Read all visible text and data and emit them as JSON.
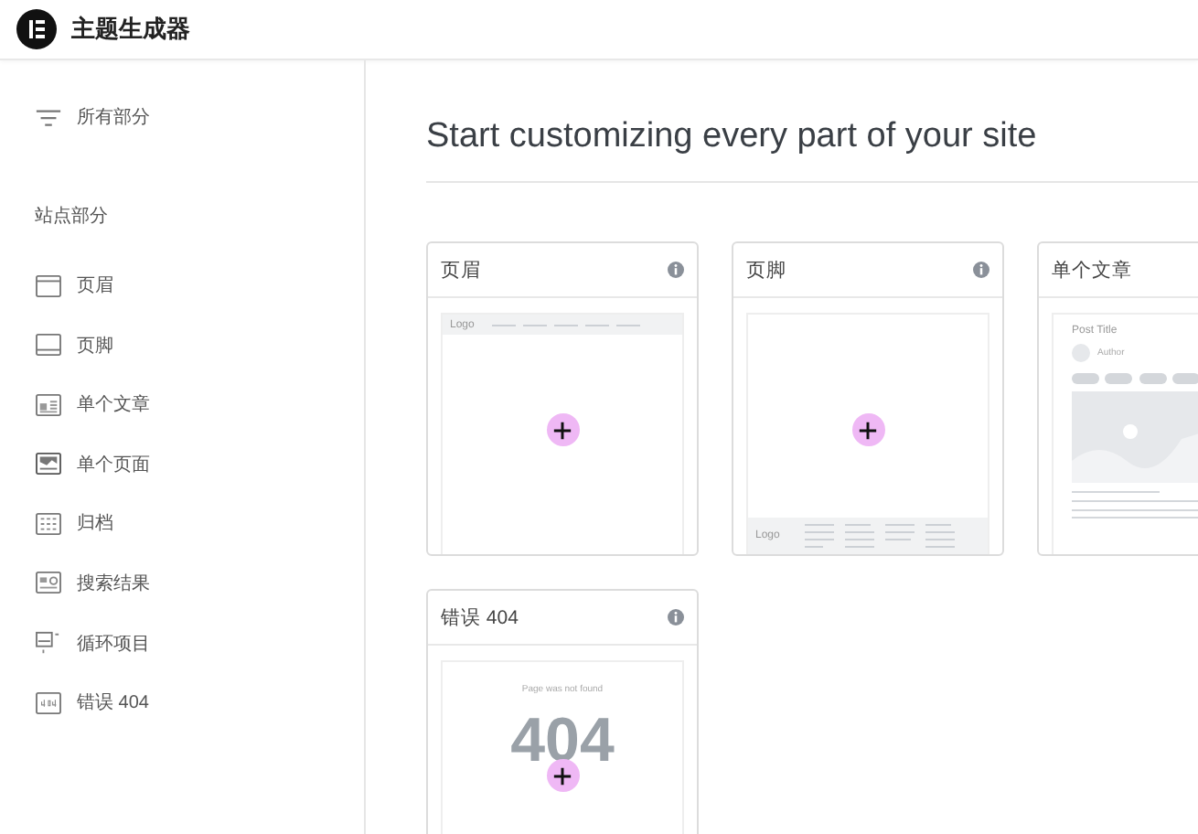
{
  "app_bar": {
    "title": "主题生成器"
  },
  "sidebar": {
    "all_parts": "所有部分",
    "section_title": "站点部分",
    "items": [
      {
        "kind": "header",
        "label": "页眉"
      },
      {
        "kind": "footer",
        "label": "页脚"
      },
      {
        "kind": "single-post",
        "label": "单个文章"
      },
      {
        "kind": "single-page",
        "label": "单个页面"
      },
      {
        "kind": "archive",
        "label": "归档"
      },
      {
        "kind": "search-results",
        "label": "搜索结果"
      },
      {
        "kind": "loop-item",
        "label": "循环项目"
      },
      {
        "kind": "error-404",
        "label": "错误 404"
      }
    ]
  },
  "main": {
    "heading": "Start customizing every part of your site",
    "cards": [
      {
        "kind": "header",
        "title": "页眉",
        "logo": "Logo"
      },
      {
        "kind": "footer",
        "title": "页脚",
        "logo": "Logo"
      },
      {
        "kind": "single-post",
        "title": "单个文章",
        "post_title": "Post Title",
        "author": "Author"
      },
      {
        "kind": "error-404",
        "title": "错误 404",
        "message": "Page was not found",
        "code": "404"
      }
    ]
  }
}
